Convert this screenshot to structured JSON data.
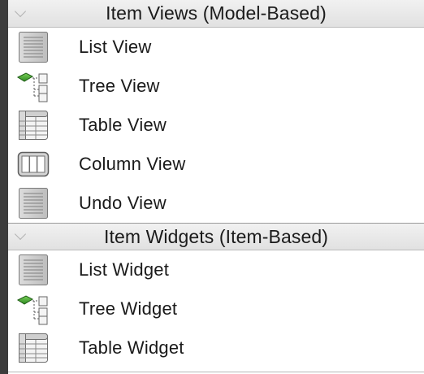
{
  "categories": [
    {
      "title": "Item Views (Model-Based)",
      "toggle_icon": "chevron-down-icon",
      "items": [
        {
          "label": "List View",
          "icon": "list-view-icon"
        },
        {
          "label": "Tree View",
          "icon": "tree-view-icon"
        },
        {
          "label": "Table View",
          "icon": "table-view-icon"
        },
        {
          "label": "Column View",
          "icon": "column-view-icon"
        },
        {
          "label": "Undo View",
          "icon": "undo-view-icon"
        }
      ]
    },
    {
      "title": "Item Widgets (Item-Based)",
      "toggle_icon": "chevron-down-icon",
      "items": [
        {
          "label": "List Widget",
          "icon": "list-widget-icon"
        },
        {
          "label": "Tree Widget",
          "icon": "tree-widget-icon"
        },
        {
          "label": "Table Widget",
          "icon": "table-widget-icon"
        }
      ]
    }
  ],
  "colors": {
    "header_bg": "#e6e6e6",
    "left_strip": "#3c3c3c",
    "tree_icon_green": "#3b9e2a"
  }
}
